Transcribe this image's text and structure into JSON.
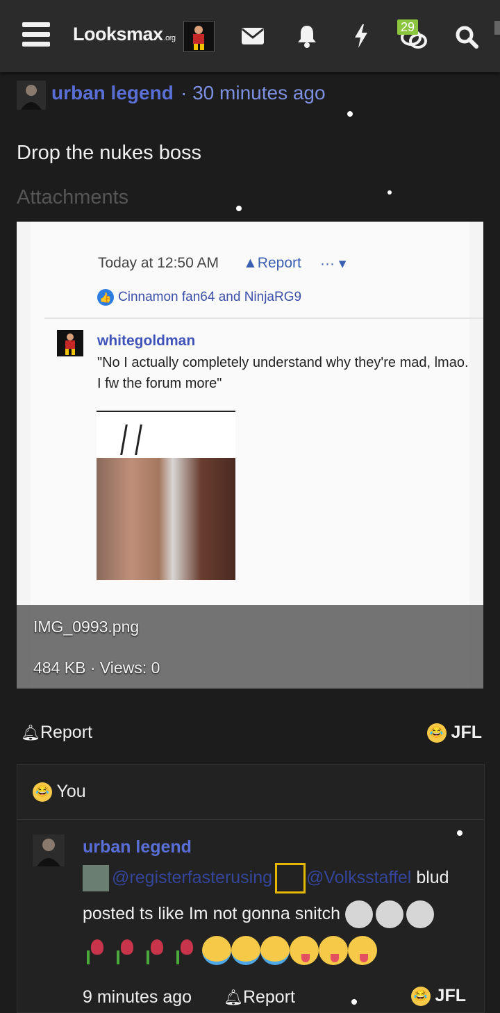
{
  "header": {
    "logo": "Looksmax",
    "logo_tld": ".org",
    "icons": [
      "menu-icon",
      "mail-icon",
      "bell-icon",
      "lightning-icon",
      "conversations-icon",
      "search-icon"
    ],
    "conversations_badge": "29"
  },
  "post": {
    "author": "urban legend",
    "separator": "·",
    "time": "30 minutes ago",
    "body": "Drop the nukes boss",
    "attachments_label": "Attachments",
    "attachment": {
      "filename": "IMG_0993.png",
      "meta": "484 KB · Views: 0",
      "screenshot": {
        "time": "Today at 12:50 AM",
        "report": "Report",
        "dots": "··· ▾",
        "likes": "Cinnamon fan64 and NinjaRG9",
        "quoted_user": "whitegoldman",
        "quoted_text": "\"No I actually completely understand why they're mad, lmao. I fw the forum more\""
      }
    },
    "actions": {
      "report": "Report",
      "reaction": "JFL"
    }
  },
  "reactions": {
    "summary": "You"
  },
  "comment": {
    "author": "urban legend",
    "mention1": "@registerfasterusing",
    "mention2": "@Volksstaffel",
    "text_after_mentions": " blud",
    "text": "posted ts like Im not gonna snitch",
    "time": "9 minutes ago",
    "report": "Report",
    "reaction": "JFL"
  },
  "colors": {
    "accent_link": "#5a6fd6",
    "badge": "#8cc63f",
    "background": "#1c1c1c"
  }
}
